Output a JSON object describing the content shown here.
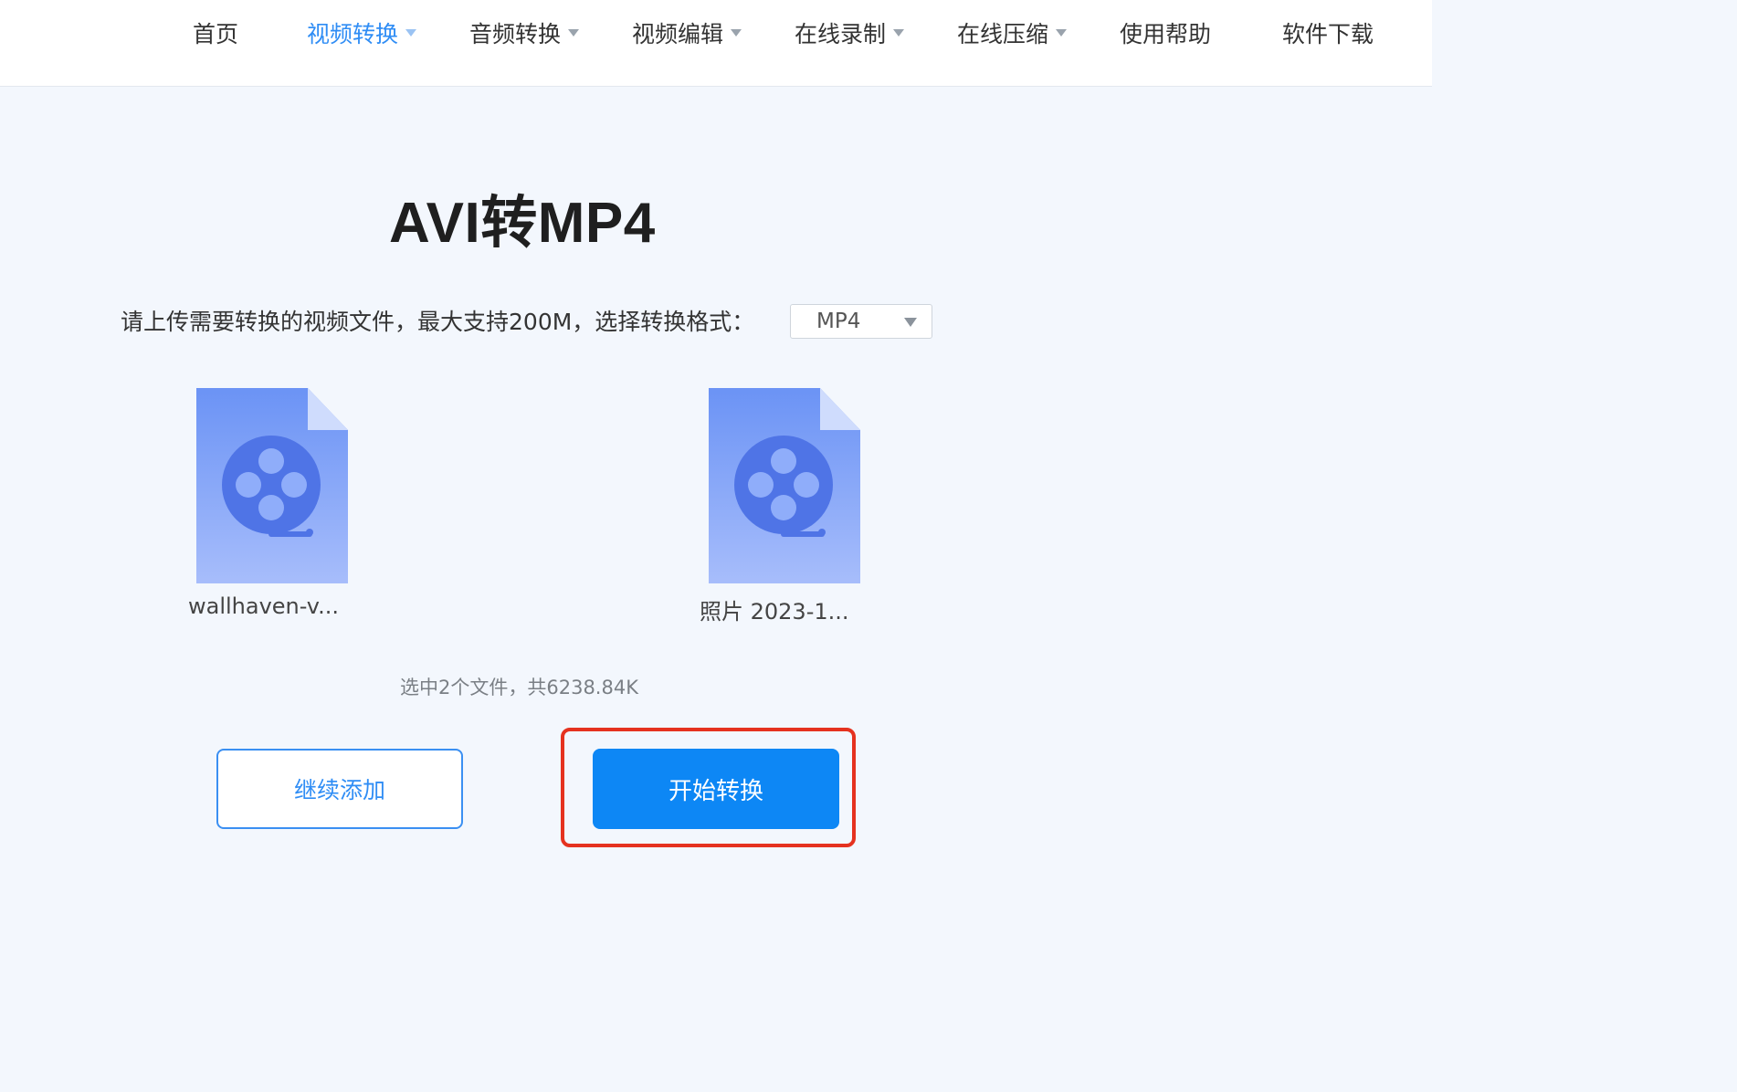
{
  "nav": {
    "items": [
      {
        "label": "首页",
        "has_dropdown": false,
        "active": false
      },
      {
        "label": "视频转换",
        "has_dropdown": true,
        "active": true
      },
      {
        "label": "音频转换",
        "has_dropdown": true,
        "active": false
      },
      {
        "label": "视频编辑",
        "has_dropdown": true,
        "active": false
      },
      {
        "label": "在线录制",
        "has_dropdown": true,
        "active": false
      },
      {
        "label": "在线压缩",
        "has_dropdown": true,
        "active": false
      },
      {
        "label": "使用帮助",
        "has_dropdown": false,
        "active": false
      },
      {
        "label": "软件下载",
        "has_dropdown": false,
        "active": false
      }
    ]
  },
  "main": {
    "title": "AVI转MP4",
    "instruction": "请上传需要转换的视频文件，最大支持200M，选择转换格式：",
    "format_select": {
      "value": "MP4"
    },
    "files": [
      {
        "name": "wallhaven-v...",
        "icon": "video-file-icon"
      },
      {
        "name": "照片 2023-1...",
        "icon": "video-file-icon"
      }
    ],
    "selection_info": "选中2个文件，共6238.84K",
    "buttons": {
      "add_more": "继续添加",
      "start_convert": "开始转换"
    }
  },
  "colors": {
    "accent": "#2f8df5",
    "primary_button": "#0d87f5",
    "highlight": "#e5321f",
    "file_icon_top": "#6b93f5",
    "file_icon_bottom": "#a7bdfb",
    "background": "#f3f7fd"
  }
}
